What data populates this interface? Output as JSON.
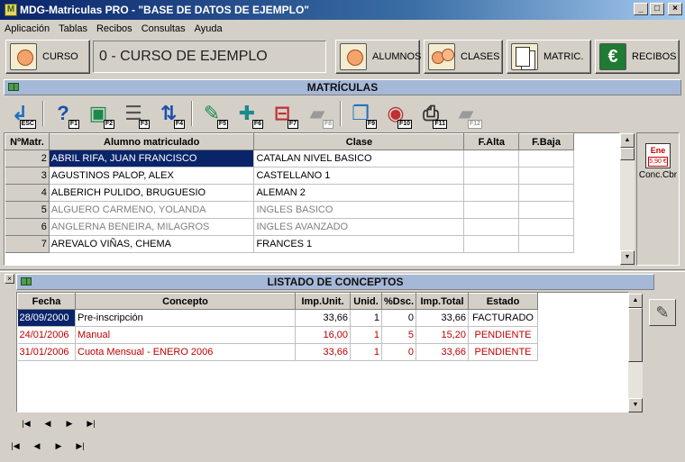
{
  "window": {
    "title": "MDG-Matriculas PRO - \"BASE DE DATOS DE EJEMPLO\"",
    "app_icon": "M"
  },
  "menu": [
    "Aplicación",
    "Tablas",
    "Recibos",
    "Consultas",
    "Ayuda"
  ],
  "top_buttons": {
    "curso": "CURSO",
    "alumnos": "ALUMNOS",
    "clases": "CLASES",
    "matric": "MATRIC.",
    "recibos": "RECIBOS"
  },
  "course_name": "0 - CURSO DE EJEMPLO",
  "matriculas": {
    "header": "MATRÍCULAS",
    "columns": [
      "NºMatr.",
      "Alumno matriculado",
      "Clase",
      "F.Alta",
      "F.Baja"
    ],
    "rows": [
      {
        "num": "2",
        "alumno": "ABRIL RIFA, JUAN FRANCISCO",
        "clase": "CATALAN NIVEL BASICO",
        "alta": "",
        "baja": ""
      },
      {
        "num": "3",
        "alumno": "AGUSTINOS PALOP, ALEX",
        "clase": "CASTELLANO 1",
        "alta": "",
        "baja": ""
      },
      {
        "num": "4",
        "alumno": "ALBERICH PULIDO, BRUGUESIO",
        "clase": "ALEMAN 2",
        "alta": "",
        "baja": ""
      },
      {
        "num": "5",
        "alumno": "ALGUERO CARMENO, YOLANDA",
        "clase": "INGLES BASICO",
        "alta": "",
        "baja": ""
      },
      {
        "num": "6",
        "alumno": "ANGLERNA BENEIRA, MILAGROS",
        "clase": "INGLES AVANZADO",
        "alta": "",
        "baja": ""
      },
      {
        "num": "7",
        "alumno": "AREVALO VIÑAS, CHEMA",
        "clase": "FRANCES 1",
        "alta": "",
        "baja": ""
      }
    ]
  },
  "toolbar": {
    "f_keys": [
      "ESC",
      "F1",
      "F2",
      "F3",
      "F4",
      "F5",
      "F6",
      "F7",
      "F8",
      "F9",
      "F10",
      "F11",
      "F12"
    ]
  },
  "side": {
    "calendar_month": "Ene",
    "calendar_price": "5,90 €",
    "label": "Conc.Cbr"
  },
  "conceptos": {
    "header": "LISTADO DE CONCEPTOS",
    "columns": [
      "Fecha",
      "Concepto",
      "Imp.Unit.",
      "Unid.",
      "%Dsc.",
      "Imp.Total",
      "Estado"
    ],
    "rows": [
      {
        "fecha": "28/09/2000",
        "concepto": "Pre-inscripción",
        "unit": "33,66",
        "unid": "1",
        "dsc": "0",
        "total": "33,66",
        "estado": "FACTURADO"
      },
      {
        "fecha": "24/01/2006",
        "concepto": "Manual",
        "unit": "16,00",
        "unid": "1",
        "dsc": "5",
        "total": "15,20",
        "estado": "PENDIENTE"
      },
      {
        "fecha": "31/01/2006",
        "concepto": "Cuota Mensual - ENERO 2006",
        "unit": "33,66",
        "unid": "1",
        "dsc": "0",
        "total": "33,66",
        "estado": "PENDIENTE"
      }
    ]
  },
  "nav_glyphs": {
    "first": "|◀",
    "prev": "◀",
    "next": "▶",
    "last": "▶|"
  },
  "colors": {
    "selection": "#0a246a",
    "pending_red": "#c00000",
    "section_header": "#a6b8d8"
  }
}
